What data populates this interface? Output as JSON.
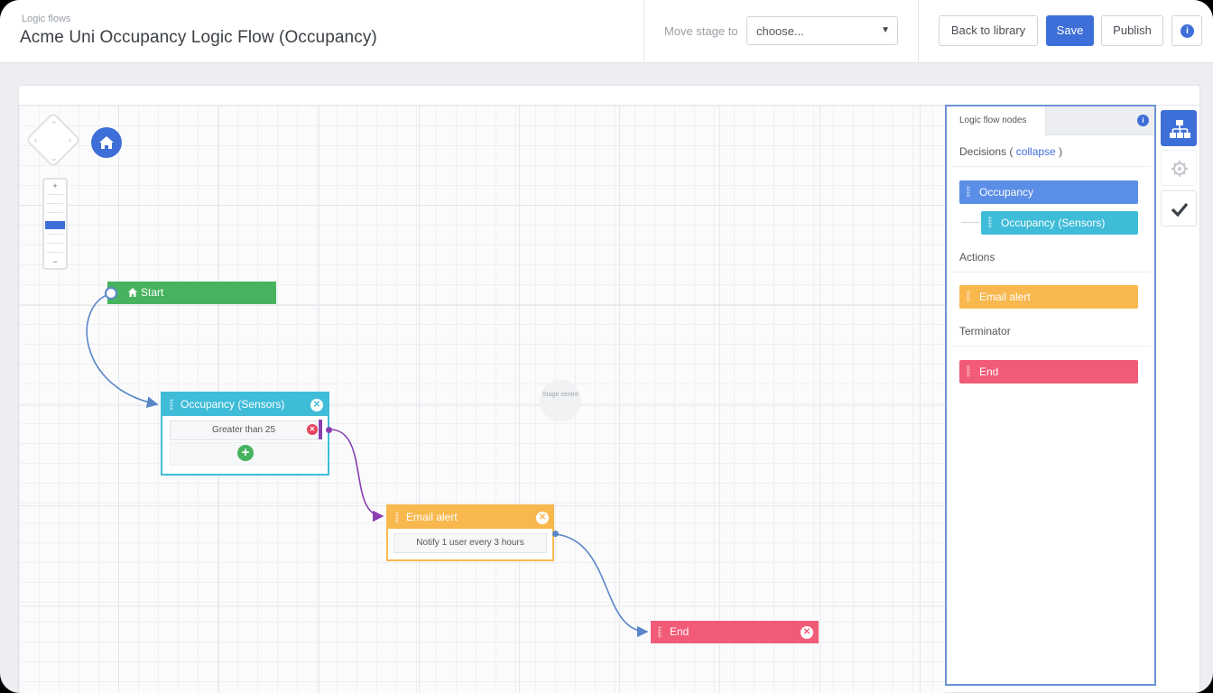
{
  "header": {
    "breadcrumb": "Logic flows",
    "title": "Acme Uni Occupancy Logic Flow (Occupancy)",
    "move_stage_label": "Move stage to",
    "move_stage_value": "choose...",
    "back_label": "Back to library",
    "save_label": "Save",
    "publish_label": "Publish"
  },
  "canvas": {
    "stage_centre": "Stage centre",
    "zoom_in": "+",
    "zoom_out": "−",
    "zoom_level_fraction": 0.45
  },
  "nodes": {
    "start": {
      "label": "Start",
      "color": "#47b35f"
    },
    "decision": {
      "label": "Occupancy (Sensors)",
      "color": "#3fbcd8",
      "rule": "Greater than 25"
    },
    "action": {
      "label": "Email alert",
      "color": "#f8b84e",
      "rule": "Notify 1 user every 3 hours"
    },
    "end": {
      "label": "End",
      "color": "#f15b78"
    }
  },
  "palette": {
    "tab_label": "Logic flow nodes",
    "decisions_label": "Decisions (",
    "collapse_label": "collapse",
    "decisions_close": ")",
    "decision_items": [
      "Occupancy",
      "Occupancy (Sensors)"
    ],
    "actions_label": "Actions",
    "action_items": [
      "Email alert"
    ],
    "terminator_label": "Terminator",
    "terminator_items": [
      "End"
    ]
  },
  "colors": {
    "primary": "#3e6fd8",
    "occupancy": "#5b8ee6",
    "connector_blue": "#5a87c8",
    "connector_purple": "#8a3fb0"
  },
  "icons": [
    "pan-icon",
    "home-icon",
    "info-icon",
    "hierarchy-icon",
    "gear-icon",
    "check-icon",
    "close-icon",
    "add-icon",
    "chevron-down-icon"
  ]
}
